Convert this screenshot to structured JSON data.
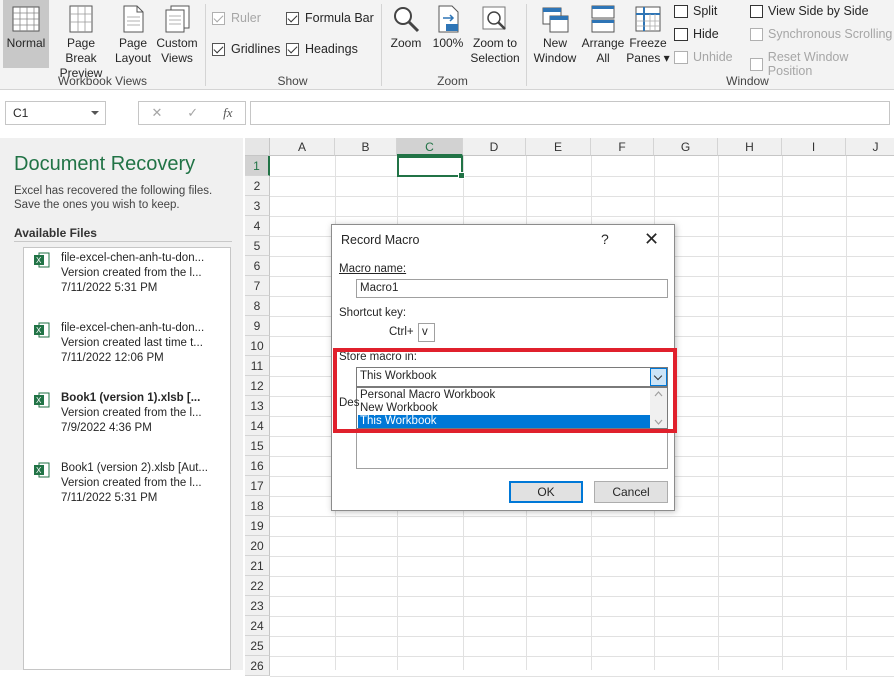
{
  "ribbon": {
    "workbook_views": {
      "normal": "Normal",
      "page_break_1": "Page Break",
      "page_break_2": "Preview",
      "page_layout_1": "Page",
      "page_layout_2": "Layout",
      "custom_1": "Custom",
      "custom_2": "Views",
      "group": "Workbook Views"
    },
    "show": {
      "ruler": "Ruler",
      "formula_bar": "Formula Bar",
      "gridlines": "Gridlines",
      "headings": "Headings",
      "group": "Show"
    },
    "zoom": {
      "zoom": "Zoom",
      "hundred": "100%",
      "sel_1": "Zoom to",
      "sel_2": "Selection",
      "group": "Zoom"
    },
    "window": {
      "new_1": "New",
      "new_2": "Window",
      "arr_1": "Arrange",
      "arr_2": "All",
      "frz_1": "Freeze",
      "frz_2": "Panes ▾",
      "split": "Split",
      "hide": "Hide",
      "unhide": "Unhide",
      "side": "View Side by Side",
      "sync": "Synchronous Scrolling",
      "reset": "Reset Window Position",
      "group": "Window"
    }
  },
  "formula_bar": {
    "name_box": "C1",
    "cancel": "✕",
    "enter": "✓",
    "fx": "fx"
  },
  "recovery": {
    "title": "Document Recovery",
    "desc_1": "Excel has recovered the following files.",
    "desc_2": "Save the ones you wish to keep.",
    "available": "Available Files",
    "files": [
      {
        "name": "file-excel-chen-anh-tu-don...",
        "note": "Version created from the l...",
        "date": "7/11/2022 5:31 PM"
      },
      {
        "name": "file-excel-chen-anh-tu-don...",
        "note": "Version created last time t...",
        "date": "7/11/2022 12:06 PM"
      },
      {
        "name": "Book1 (version 1).xlsb  [...",
        "note": "Version created from the l...",
        "date": "7/9/2022 4:36 PM"
      },
      {
        "name": "Book1 (version 2).xlsb  [Aut...",
        "note": "Version created from the l...",
        "date": "7/11/2022 5:31 PM"
      }
    ]
  },
  "sheet": {
    "columns": [
      "A",
      "B",
      "C",
      "D",
      "E",
      "F",
      "G",
      "H",
      "I",
      "J"
    ],
    "rows": [
      "1",
      "2",
      "3",
      "4",
      "5",
      "6",
      "7",
      "8",
      "9",
      "10",
      "11",
      "12",
      "13",
      "14",
      "15",
      "16",
      "17",
      "18",
      "19",
      "20",
      "21",
      "22",
      "23",
      "24",
      "25",
      "26"
    ]
  },
  "dialog": {
    "title": "Record Macro",
    "help": "?",
    "close": "✕",
    "macro_name_label": "Macro name:",
    "macro_name_value": "Macro1",
    "shortcut_label": "Shortcut key:",
    "ctrl_label": "Ctrl+",
    "shortcut_value": "v",
    "store_label": "Store macro in:",
    "store_value": "This Workbook",
    "store_options": [
      "Personal Macro Workbook",
      "New Workbook",
      "This Workbook"
    ],
    "desc_label": "Des",
    "ok": "OK",
    "cancel": "Cancel"
  },
  "colors": {
    "excel_green": "#217346",
    "highlight_red": "#e0202c",
    "selection_blue": "#0078d7"
  }
}
